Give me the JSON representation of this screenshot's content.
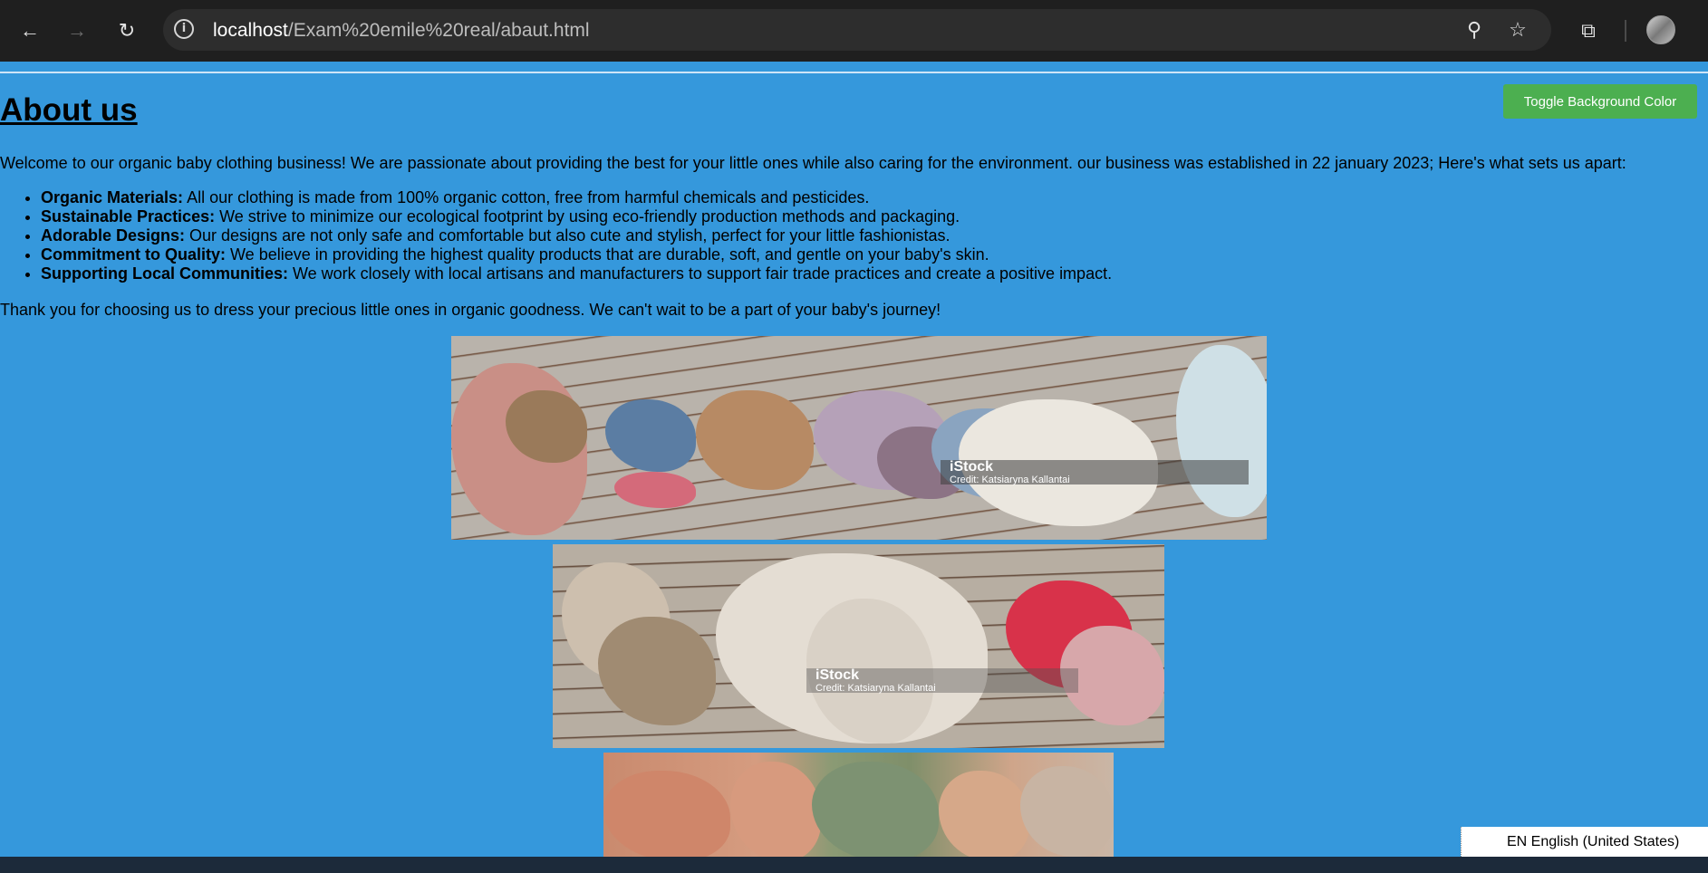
{
  "browser": {
    "url_host": "localhost",
    "url_path": "/Exam%20emile%20real/abaut.html",
    "icons": {
      "back": "back-arrow-icon",
      "forward": "forward-arrow-icon",
      "reload": "reload-icon",
      "site_info": "info-icon",
      "zoom": "zoom-icon",
      "bookmark": "star-icon",
      "extensions": "puzzle-piece-icon",
      "profile": "avatar"
    },
    "info_glyph": "i"
  },
  "page": {
    "title": "About us",
    "toggle_button_label": "Toggle Background Color",
    "background_color": "#3598dc",
    "button_color": "#4caf50",
    "intro": "Welcome to our organic baby clothing business! We are passionate about providing the best for your little ones while also caring for the environment. our business was established in 22 january 2023; Here's what sets us apart:",
    "features": [
      {
        "term": "Organic Materials:",
        "text": " All our clothing is made from 100% organic cotton, free from harmful chemicals and pesticides."
      },
      {
        "term": "Sustainable Practices:",
        "text": " We strive to minimize our ecological footprint by using eco-friendly production methods and packaging."
      },
      {
        "term": "Adorable Designs:",
        "text": " Our designs are not only safe and comfortable but also cute and stylish, perfect for your little fashionistas."
      },
      {
        "term": "Commitment to Quality:",
        "text": " We believe in providing the highest quality products that are durable, soft, and gentle on your baby's skin."
      },
      {
        "term": "Supporting Local Communities:",
        "text": " We work closely with local artisans and manufacturers to support fair trade practices and create a positive impact."
      }
    ],
    "thanks": "Thank you for choosing us to dress your precious little ones in organic goodness. We can't wait to be a part of your baby's journey!",
    "images": [
      {
        "watermark_brand": "iStock",
        "watermark_credit": "Credit: Katsiaryna Kallantai"
      },
      {
        "watermark_brand": "iStock",
        "watermark_credit": "Credit: Katsiaryna Kallantai"
      },
      {
        "watermark_brand": "",
        "watermark_credit": ""
      }
    ]
  },
  "os": {
    "language_indicator": "EN English (United States)"
  }
}
